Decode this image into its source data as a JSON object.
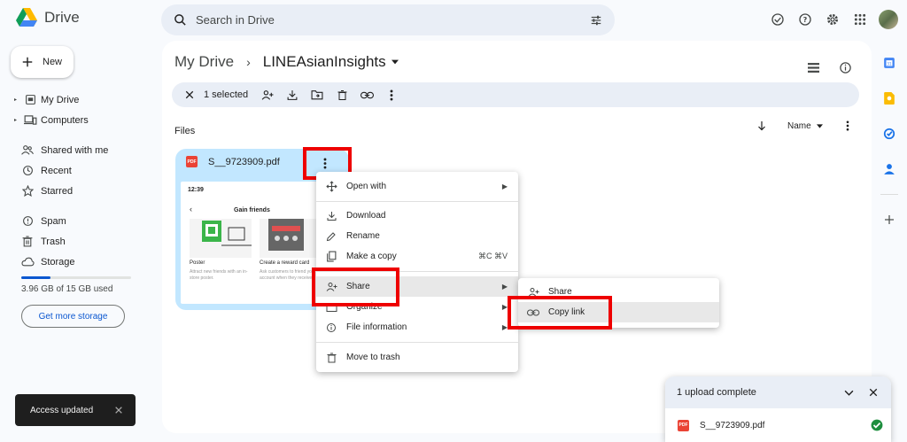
{
  "app": {
    "title": "Drive"
  },
  "search": {
    "placeholder": "Search in Drive"
  },
  "sidebar": {
    "new_label": "New",
    "items": [
      {
        "label": "My Drive"
      },
      {
        "label": "Computers"
      },
      {
        "label": "Shared with me"
      },
      {
        "label": "Recent"
      },
      {
        "label": "Starred"
      },
      {
        "label": "Spam"
      },
      {
        "label": "Trash"
      },
      {
        "label": "Storage"
      }
    ],
    "storage_used_fraction": 0.264,
    "storage_text": "3.96 GB of 15 GB used",
    "get_storage_label": "Get more storage"
  },
  "toast": {
    "text": "Access updated"
  },
  "breadcrumb": {
    "root": "My Drive",
    "separator": "›",
    "current": "LINEAsianInsights"
  },
  "selection": {
    "count_label": "1 selected"
  },
  "files": {
    "section_label": "Files",
    "sort_label": "Name"
  },
  "file_card": {
    "name": "S__9723909.pdf",
    "badge": "PDF",
    "thumb": {
      "time": "12:39",
      "title": "Gain friends",
      "item1_title": "Poster",
      "item1_desc": "Attract new friends with an in-store poster.",
      "item2_title": "Create a reward card",
      "item2_desc": "Ask customers to friend your account when they receive"
    }
  },
  "context_menu": {
    "open_with": "Open with",
    "download": "Download",
    "rename": "Rename",
    "make_copy": "Make a copy",
    "make_copy_shortcut": "⌘C ⌘V",
    "share": "Share",
    "organize": "Organize",
    "file_info": "File information",
    "move_to_trash": "Move to trash"
  },
  "share_submenu": {
    "share": "Share",
    "copy_link": "Copy link"
  },
  "upload_panel": {
    "title": "1 upload complete",
    "file_name": "S__9723909.pdf"
  },
  "colors": {
    "accent": "#0b57d0",
    "selected_card": "#c2e7ff",
    "highlight_box": "#e00000"
  }
}
